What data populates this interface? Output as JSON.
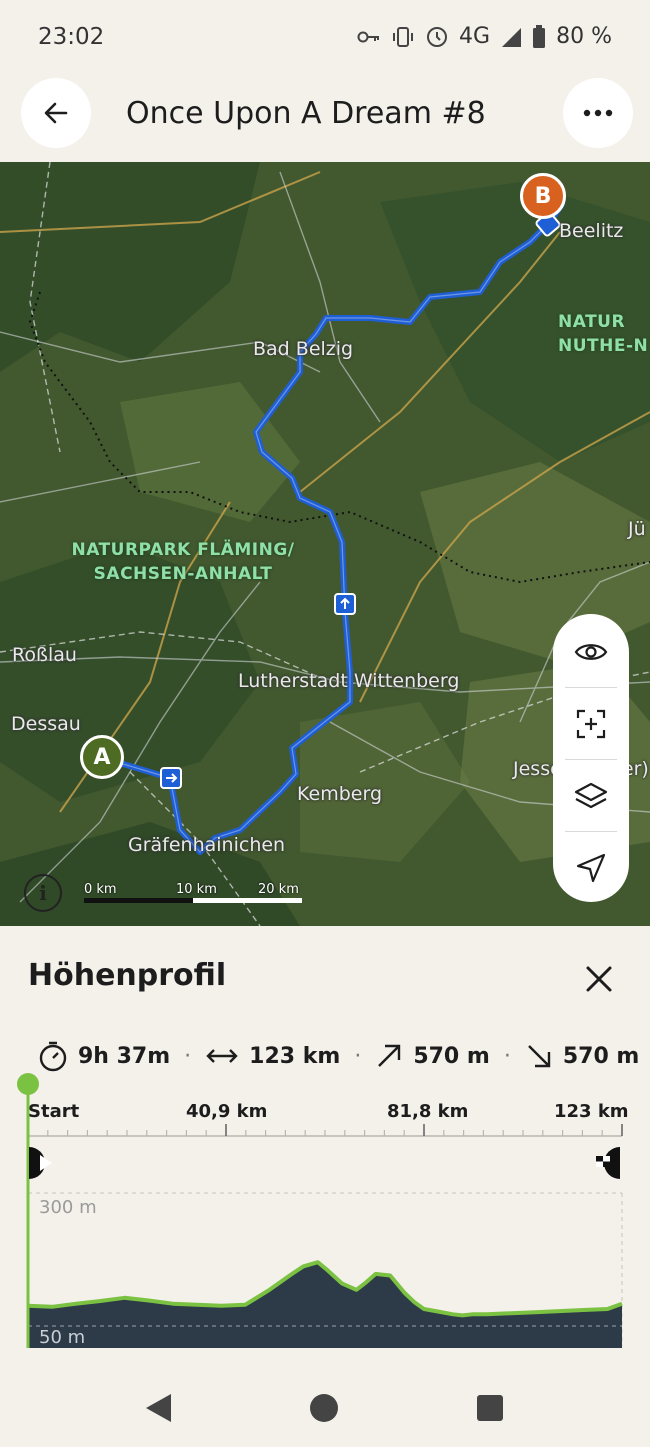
{
  "status_bar": {
    "time": "23:02",
    "network": "4G",
    "battery": "80 %"
  },
  "app_bar": {
    "title": "Once Upon A Dream #8"
  },
  "map": {
    "places": [
      "Beelitz",
      "Bad Belzig",
      "Roßlau",
      "Dessau",
      "Lutherstadt Wittenberg",
      "Kemberg",
      "Gräfenhainichen",
      "Jessen (Elster)",
      "Jü"
    ],
    "parks": [
      "NATURPARK FLÄMING/",
      "SACHSEN-ANHALT",
      "NATUR",
      "NUTHE-N"
    ],
    "markers": {
      "start": "A",
      "end": "B"
    },
    "scale": [
      "0 km",
      "10 km",
      "20 km"
    ],
    "info_label": "i",
    "route_color": "#1f5fd6"
  },
  "map_controls": [
    {
      "name": "visibility",
      "icon": "eye-icon"
    },
    {
      "name": "recenter",
      "icon": "fit-bounds-icon"
    },
    {
      "name": "layers",
      "icon": "layers-icon"
    },
    {
      "name": "navigate",
      "icon": "navigation-arrow-icon"
    }
  ],
  "profile": {
    "title": "Höhenprofil",
    "stats": {
      "duration": "9h 37m",
      "distance": "123 km",
      "ascent": "570 m",
      "descent": "570 m"
    },
    "x_axis": [
      "Start",
      "40,9 km",
      "81,8 km",
      "123 km"
    ],
    "y_axis": [
      "300 m",
      "50 m"
    ],
    "accent_color": "#7cc242"
  },
  "chart_data": {
    "type": "area",
    "xlabel": "",
    "ylabel": "",
    "xlim": [
      0,
      123
    ],
    "ylim": [
      50,
      300
    ],
    "x": [
      0,
      5,
      10,
      15,
      20,
      25,
      30,
      35,
      40,
      45,
      50,
      55,
      57,
      60,
      62,
      65,
      68,
      70,
      72,
      75,
      78,
      80,
      82,
      85,
      88,
      90,
      92,
      95,
      100,
      105,
      110,
      115,
      120,
      123
    ],
    "series": [
      {
        "values": [
          88,
          86,
          92,
          97,
          103,
          98,
          92,
          90,
          88,
          90,
          118,
          150,
          162,
          170,
          155,
          130,
          118,
          132,
          148,
          145,
          112,
          95,
          82,
          77,
          72,
          70,
          72,
          72,
          74,
          76,
          78,
          80,
          82,
          92
        ]
      }
    ]
  }
}
